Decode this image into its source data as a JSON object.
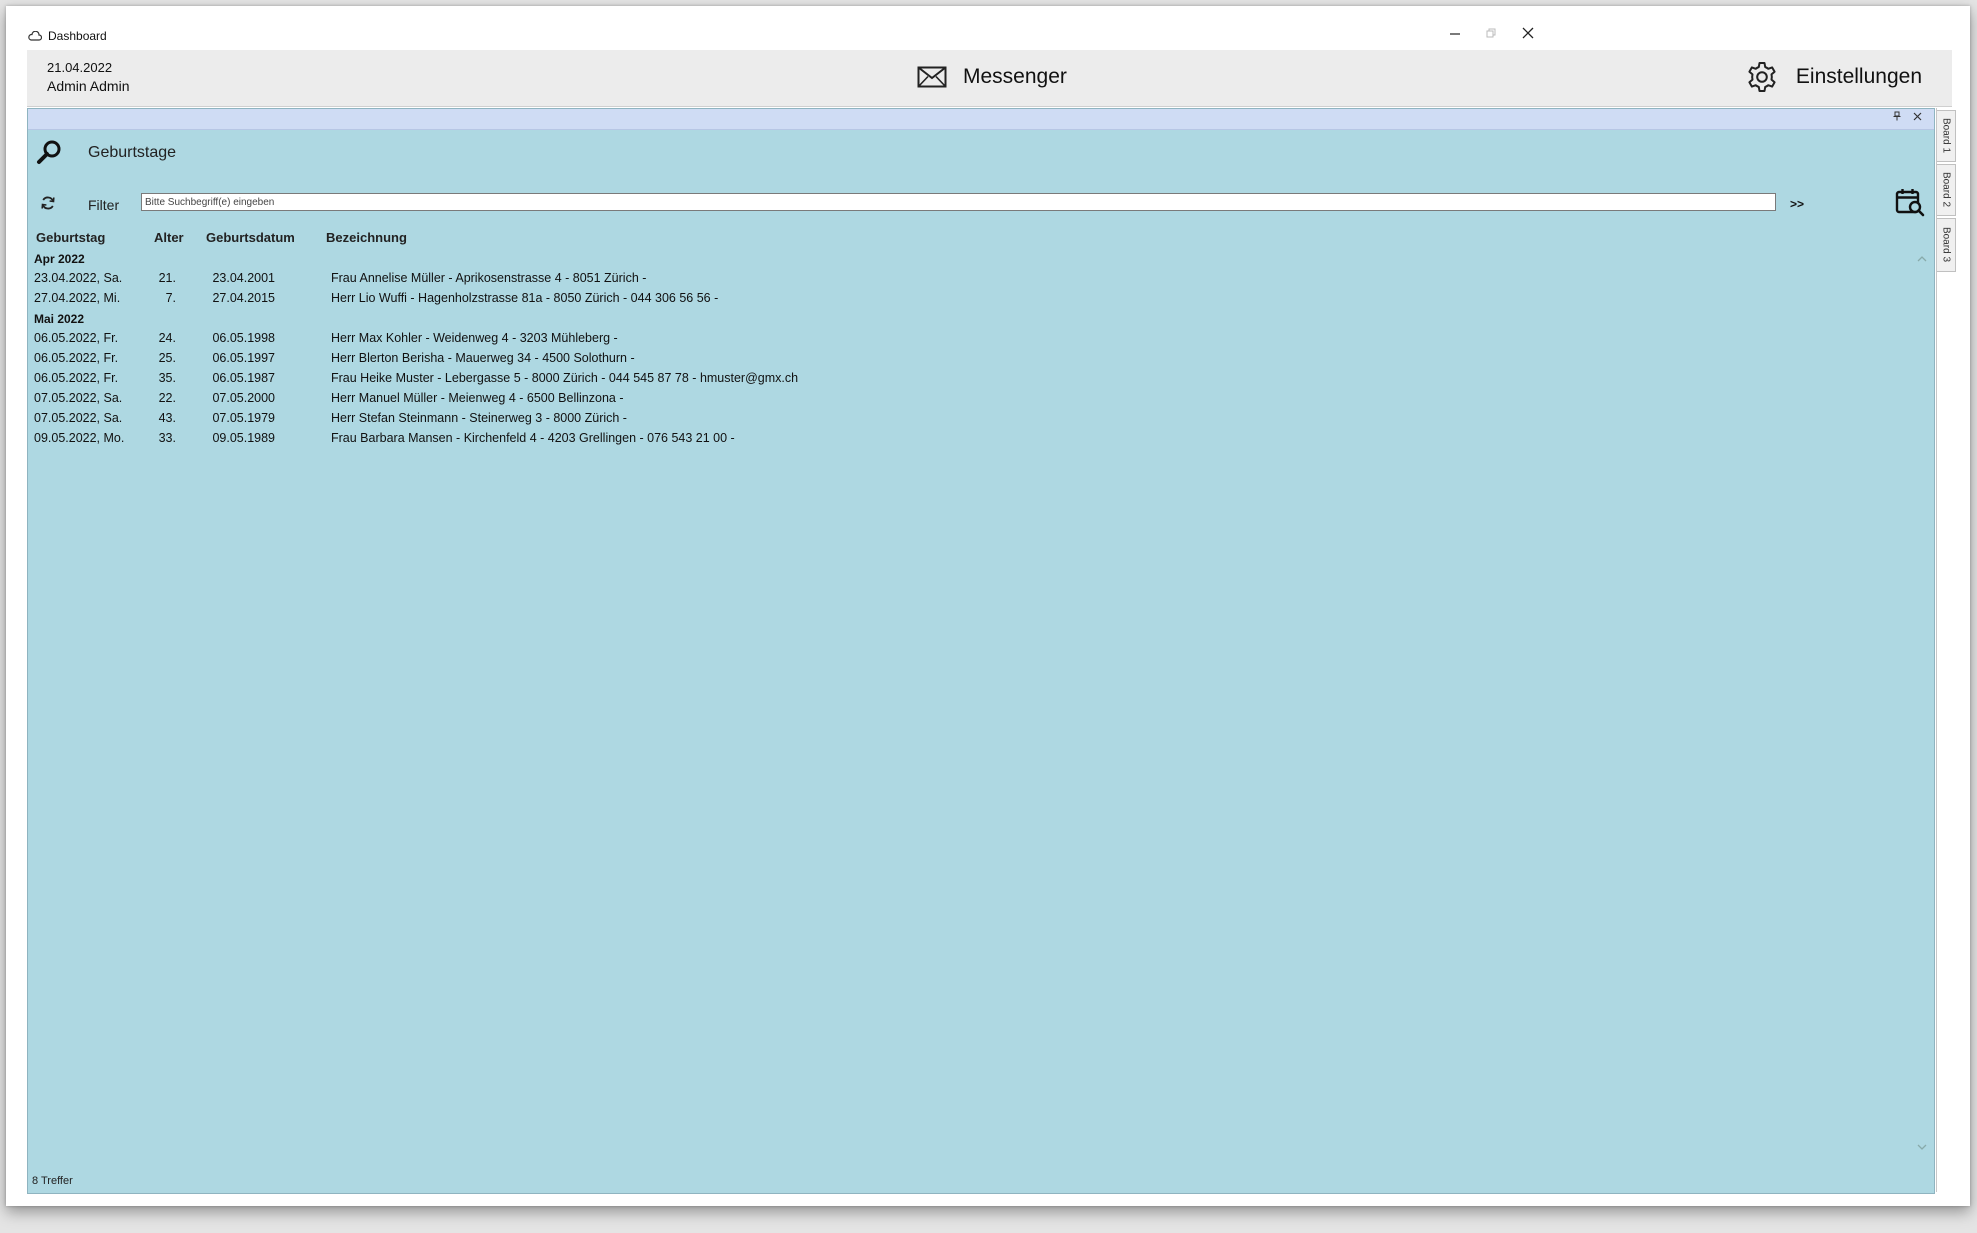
{
  "window": {
    "title": "Dashboard"
  },
  "header": {
    "date": "21.04.2022",
    "user": "Admin Admin",
    "messenger_label": "Messenger",
    "settings_label": "Einstellungen"
  },
  "panel": {
    "title": "Geburtstage",
    "filter_label": "Filter",
    "filter_placeholder": "Bitte Suchbegriff(e) eingeben",
    "filter_value": "",
    "go_label": ">>",
    "columns": {
      "birthday": "Geburtstag",
      "age": "Alter",
      "birthdate": "Geburtsdatum",
      "description": "Bezeichnung"
    },
    "groups": [
      {
        "label": "Apr 2022",
        "rows": [
          {
            "birthday": "23.04.2022, Sa.",
            "age": "21.",
            "birthdate": "23.04.2001",
            "description": "Frau Annelise Müller - Aprikosenstrasse 4 - 8051 Zürich -"
          },
          {
            "birthday": "27.04.2022, Mi.",
            "age": "7.",
            "birthdate": "27.04.2015",
            "description": "Herr Lio Wuffi - Hagenholzstrasse 81a - 8050 Zürich - 044 306 56 56 -"
          }
        ]
      },
      {
        "label": "Mai 2022",
        "rows": [
          {
            "birthday": "06.05.2022, Fr.",
            "age": "24.",
            "birthdate": "06.05.1998",
            "description": "Herr Max Kohler - Weidenweg 4 - 3203 Mühleberg -"
          },
          {
            "birthday": "06.05.2022, Fr.",
            "age": "25.",
            "birthdate": "06.05.1997",
            "description": "Herr Blerton Berisha - Mauerweg 34 - 4500 Solothurn -"
          },
          {
            "birthday": "06.05.2022, Fr.",
            "age": "35.",
            "birthdate": "06.05.1987",
            "description": "Frau Heike Muster - Lebergasse 5 - 8000 Zürich - 044 545 87 78 - hmuster@gmx.ch"
          },
          {
            "birthday": "07.05.2022, Sa.",
            "age": "22.",
            "birthdate": "07.05.2000",
            "description": "Herr Manuel Müller - Meienweg 4 - 6500 Bellinzona -"
          },
          {
            "birthday": "07.05.2022, Sa.",
            "age": "43.",
            "birthdate": "07.05.1979",
            "description": "Herr Stefan Steinmann - Steinerweg 3 - 8000 Zürich -"
          },
          {
            "birthday": "09.05.2022, Mo.",
            "age": "33.",
            "birthdate": "09.05.1989",
            "description": "Frau Barbara Mansen - Kirchenfeld 4 - 4203 Grellingen - 076 543 21 00 -"
          }
        ]
      }
    ],
    "status": "8 Treffer"
  },
  "side_tabs": [
    "Board 1",
    "Board 2",
    "Board 3"
  ],
  "colors": {
    "panel_bg": "#aed8e2",
    "caption_bg": "#cfdcf4",
    "header_bg": "#ececec"
  },
  "icons": [
    "cloud-icon",
    "minimize-icon",
    "restore-icon",
    "close-icon",
    "mail-icon",
    "gear-icon",
    "search-icon",
    "refresh-icon",
    "calendar-search-icon",
    "pin-icon"
  ]
}
